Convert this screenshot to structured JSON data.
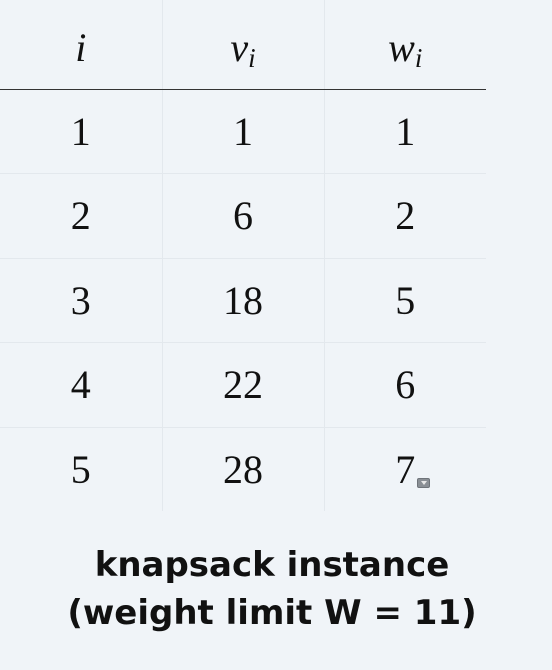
{
  "table": {
    "headers": {
      "i": "i",
      "v": {
        "base": "v",
        "sub": "i"
      },
      "w": {
        "base": "w",
        "sub": "i"
      }
    },
    "rows": [
      {
        "i": "1",
        "v": "1",
        "w": "1"
      },
      {
        "i": "2",
        "v": "6",
        "w": "2"
      },
      {
        "i": "3",
        "v": "18",
        "w": "5"
      },
      {
        "i": "4",
        "v": "22",
        "w": "6"
      },
      {
        "i": "5",
        "v": "28",
        "w": "7"
      }
    ]
  },
  "caption": {
    "line1": "knapsack instance",
    "line2": "(weight limit W = 11)"
  },
  "icons": {
    "dropdown": "chevron-down-icon"
  }
}
